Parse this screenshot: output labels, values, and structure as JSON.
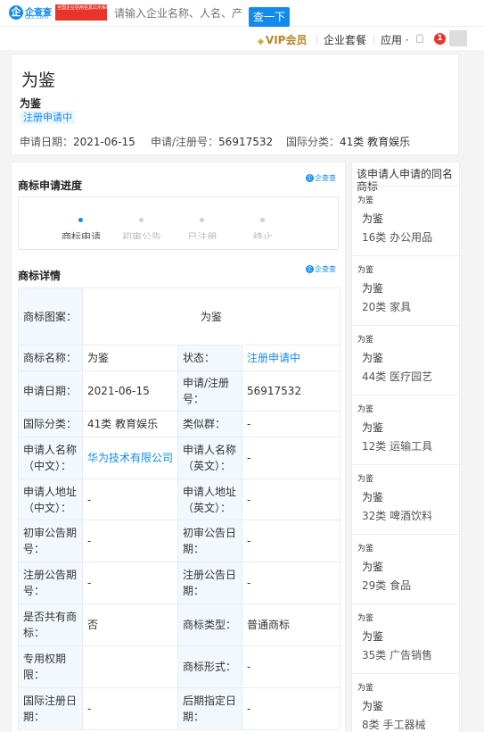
{
  "header": {
    "logo_name": "企查查",
    "logo_domain": "Qcc.com",
    "badge_text": "全国企业信用信息公示系统 官方备案企业征信机构",
    "search_placeholder": "请输入企业名称、人名、产",
    "search_button": "查一下"
  },
  "nav": {
    "vip": "VIP会员",
    "package": "企业套餐",
    "apps": "应用 ·",
    "notification_count": "1"
  },
  "summary": {
    "title": "为鉴",
    "subtitle": "为鉴",
    "status": "注册申请中",
    "apply_date_label": "申请日期：",
    "apply_date": "2021-06-15",
    "reg_no_label": "申请/注册号：",
    "reg_no": "56917532",
    "class_label": "国际分类：",
    "class_value": "41类 教育娱乐"
  },
  "progress": {
    "title": "商标申请进度",
    "brand": "企查查",
    "steps": [
      {
        "label": "商标申请",
        "active": true
      },
      {
        "label": "初审公告",
        "active": false
      },
      {
        "label": "已注册",
        "active": false
      },
      {
        "label": "终止",
        "active": false
      }
    ]
  },
  "details": {
    "title": "商标详情",
    "brand": "企查查",
    "mark_image_label": "商标图案：",
    "mark_image_text": "为鉴",
    "name_label": "商标名称：",
    "name_value": "为鉴",
    "status_label": "状态：",
    "status_value": "注册申请中",
    "date_label": "申请日期：",
    "date_value": "2021-06-15",
    "regno_label": "申请/注册号：",
    "regno_value": "56917532",
    "class_label": "国际分类：",
    "class_value": "41类 教育娱乐",
    "group_label": "类似群：",
    "group_value": "-",
    "applicant_cn_label": "申请人名称（中文）：",
    "applicant_cn_value": "华为技术有限公司",
    "applicant_en_label": "申请人名称（英文）：",
    "applicant_en_value": "-",
    "addr_cn_label": "申请人地址（中文）：",
    "addr_cn_value": "-",
    "addr_en_label": "申请人地址（英文）：",
    "addr_en_value": "-",
    "prelim_no_label": "初审公告期号：",
    "prelim_no_value": "-",
    "prelim_date_label": "初审公告日期：",
    "prelim_date_value": "-",
    "reg_no_label": "注册公告期号：",
    "reg_no_value": "-",
    "reg_date_label": "注册公告日期：",
    "reg_date_value": "-",
    "shared_label": "是否共有商标：",
    "shared_value": "否",
    "type_label": "商标类型：",
    "type_value": "普通商标",
    "term_label": "专用权期限：",
    "term_value": "",
    "form_label": "商标形式：",
    "form_value": "-",
    "intl_date_label": "国际注册日期：",
    "intl_date_value": "-",
    "later_date_label": "后期指定日期：",
    "later_date_value": "-"
  },
  "sidebar": {
    "title": "该申请人申请的同名商标",
    "items": [
      {
        "thumb": "为鉴",
        "name": "为鉴",
        "class": "16类 办公用品"
      },
      {
        "thumb": "为鉴",
        "name": "为鉴",
        "class": "20类 家具"
      },
      {
        "thumb": "为鉴",
        "name": "为鉴",
        "class": "44类 医疗园艺"
      },
      {
        "thumb": "为鉴",
        "name": "为鉴",
        "class": "12类 运输工具"
      },
      {
        "thumb": "为鉴",
        "name": "为鉴",
        "class": "32类 啤酒饮料"
      },
      {
        "thumb": "为鉴",
        "name": "为鉴",
        "class": "29类 食品"
      },
      {
        "thumb": "为鉴",
        "name": "为鉴",
        "class": "35类 广告销售"
      },
      {
        "thumb": "为鉴",
        "name": "为鉴",
        "class": "8类 手工器械"
      }
    ]
  }
}
